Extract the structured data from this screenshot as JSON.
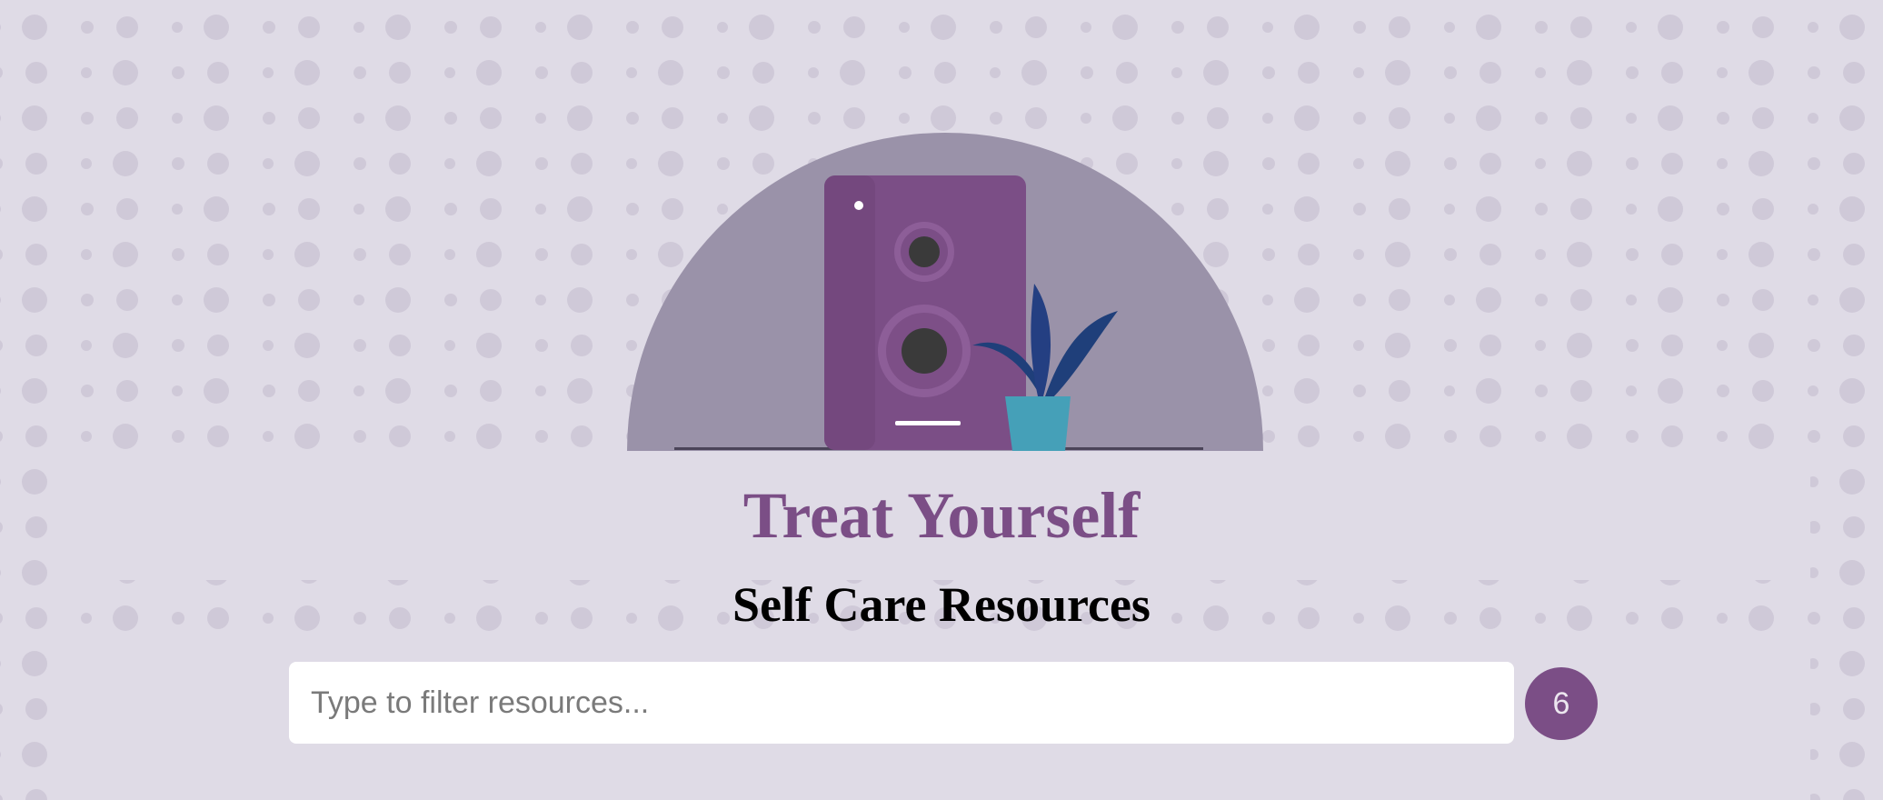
{
  "header": {
    "title": "Treat Yourself",
    "subtitle": "Self Care Resources"
  },
  "search": {
    "placeholder": "Type to filter resources...",
    "value": ""
  },
  "results": {
    "count": "6"
  },
  "illustration": {
    "subject": "speaker-and-plant",
    "colors": {
      "background_arch": "#9a92a9",
      "speaker": "#7b4e86",
      "plant_leaves": "#1f3f7a",
      "pot": "#45a0b8"
    }
  },
  "colors": {
    "page_background": "#dfdbe6",
    "accent": "#7b4e86",
    "dots": "#cfc9d8"
  }
}
